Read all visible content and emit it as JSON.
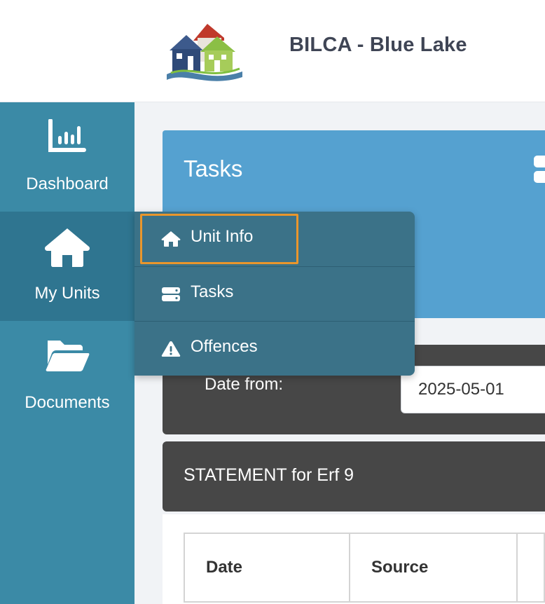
{
  "header": {
    "brand_title": "BILCA - Blue Lake",
    "logo_icon": "houses-logo-icon"
  },
  "sidebar": {
    "items": [
      {
        "label": "Dashboard",
        "icon": "bar-chart-icon"
      },
      {
        "label": "My Units",
        "icon": "home-icon",
        "active": true
      },
      {
        "label": "Documents",
        "icon": "folder-open-icon"
      }
    ]
  },
  "dropdown": {
    "items": [
      {
        "label": "Unit Info",
        "icon": "home-icon",
        "focused": true
      },
      {
        "label": "Tasks",
        "icon": "server-icon"
      },
      {
        "label": "Offences",
        "icon": "warning-icon"
      }
    ]
  },
  "main": {
    "tasks_title": "Tasks",
    "filter": {
      "date_from_label": "Date from:",
      "date_from_value": "2025-05-01"
    },
    "statement_title": "STATEMENT for Erf 9",
    "table": {
      "columns": [
        "Date",
        "Source",
        ""
      ]
    }
  },
  "colors": {
    "sidebar": "#3b8aa6",
    "sidebar_active": "#2f7590",
    "dropdown": "#3b7288",
    "tasks_card": "#55a1d0",
    "panel_dark": "#474747",
    "focus_outline": "#e9962c",
    "brand_text": "#3f4555"
  }
}
